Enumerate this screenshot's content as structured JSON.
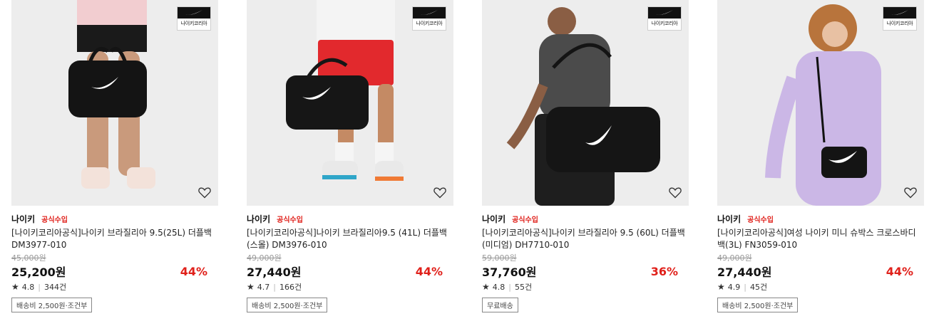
{
  "badge_text": "나이키코리아",
  "products": [
    {
      "brand": "나이키",
      "official": "공식수입",
      "title": "[나이키코리아공식]나이키 브라질리아 9.5(25L) 더플백 DM3977-010",
      "original_price": "45,000원",
      "price": "25,200원",
      "discount": "44%",
      "rating": "4.8",
      "reviews": "344건",
      "shipping": "배송비 2,500원·조건부"
    },
    {
      "brand": "나이키",
      "official": "공식수입",
      "title": "[나이키코리아공식]나이키 브라질리아9.5 (41L) 더플백(스몰) DM3976-010",
      "original_price": "49,000원",
      "price": "27,440원",
      "discount": "44%",
      "rating": "4.7",
      "reviews": "166건",
      "shipping": "배송비 2,500원·조건부"
    },
    {
      "brand": "나이키",
      "official": "공식수입",
      "title": "[나이키코리아공식]나이키 브라질리아 9.5 (60L) 더플백(미디엄) DH7710-010",
      "original_price": "59,000원",
      "price": "37,760원",
      "discount": "36%",
      "rating": "4.8",
      "reviews": "55건",
      "shipping": "무료배송"
    },
    {
      "brand": "나이키",
      "official": "공식수입",
      "title": "[나이키코리아공식]여성 나이키 미니 슈박스 크로스바디 백(3L) FN3059-010",
      "original_price": "49,000원",
      "price": "27,440원",
      "discount": "44%",
      "rating": "4.9",
      "reviews": "45건",
      "shipping": "배송비 2,500원·조건부"
    }
  ],
  "colors": {
    "discount": "#e0201a",
    "official": "#e0201a",
    "thumb_bg": "#ececec"
  },
  "icons": {
    "wishlist": "heart-outline-icon",
    "rating": "star-icon",
    "brand_logo": "swoosh-icon"
  }
}
